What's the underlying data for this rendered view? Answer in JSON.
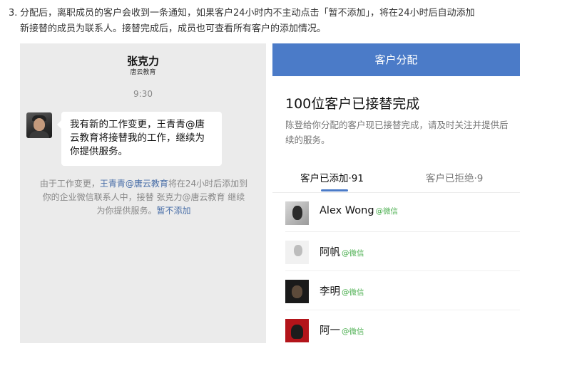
{
  "instruction": {
    "number": "3.",
    "line1": "分配后，离职成员的客户会收到一条通知，如果客户24小时内不主动点击「暂不添加」，将在24小时后自动添加",
    "line2": "新接替的成员为联系人。接替完成后，成员也可查看所有客户的添加情况。"
  },
  "chat": {
    "contact_name": "张克力",
    "contact_org": "唐云教育",
    "time": "9:30",
    "message": "我有新的工作变更，王青青@唐云教育将接替我的工作，继续为你提供服务。",
    "note_prefix": "由于工作变更，",
    "note_link1": "王青青@唐云教育",
    "note_middle": "将在24小时后添加到你的企业微信联系人中，接替 张克力@唐云教育 继续为你提供服务。",
    "note_link2": "暂不添加"
  },
  "panel": {
    "header": "客户分配",
    "title": "100位客户已接替完成",
    "description": "陈登给你分配的客户现已接替完成，请及时关注并提供后续的服务。",
    "tabs": [
      {
        "label": "客户已添加·91"
      },
      {
        "label": "客户已拒绝·9"
      }
    ],
    "customers": [
      {
        "name": "Alex Wong",
        "tag": "@微信"
      },
      {
        "name": "阿帆",
        "tag": "@微信"
      },
      {
        "name": "李明",
        "tag": "@微信"
      },
      {
        "name": "阿一",
        "tag": "@微信"
      }
    ]
  },
  "colors": {
    "accent": "#4b7bc8",
    "wechat_tag": "#4caf50",
    "link": "#4a6fa8"
  }
}
